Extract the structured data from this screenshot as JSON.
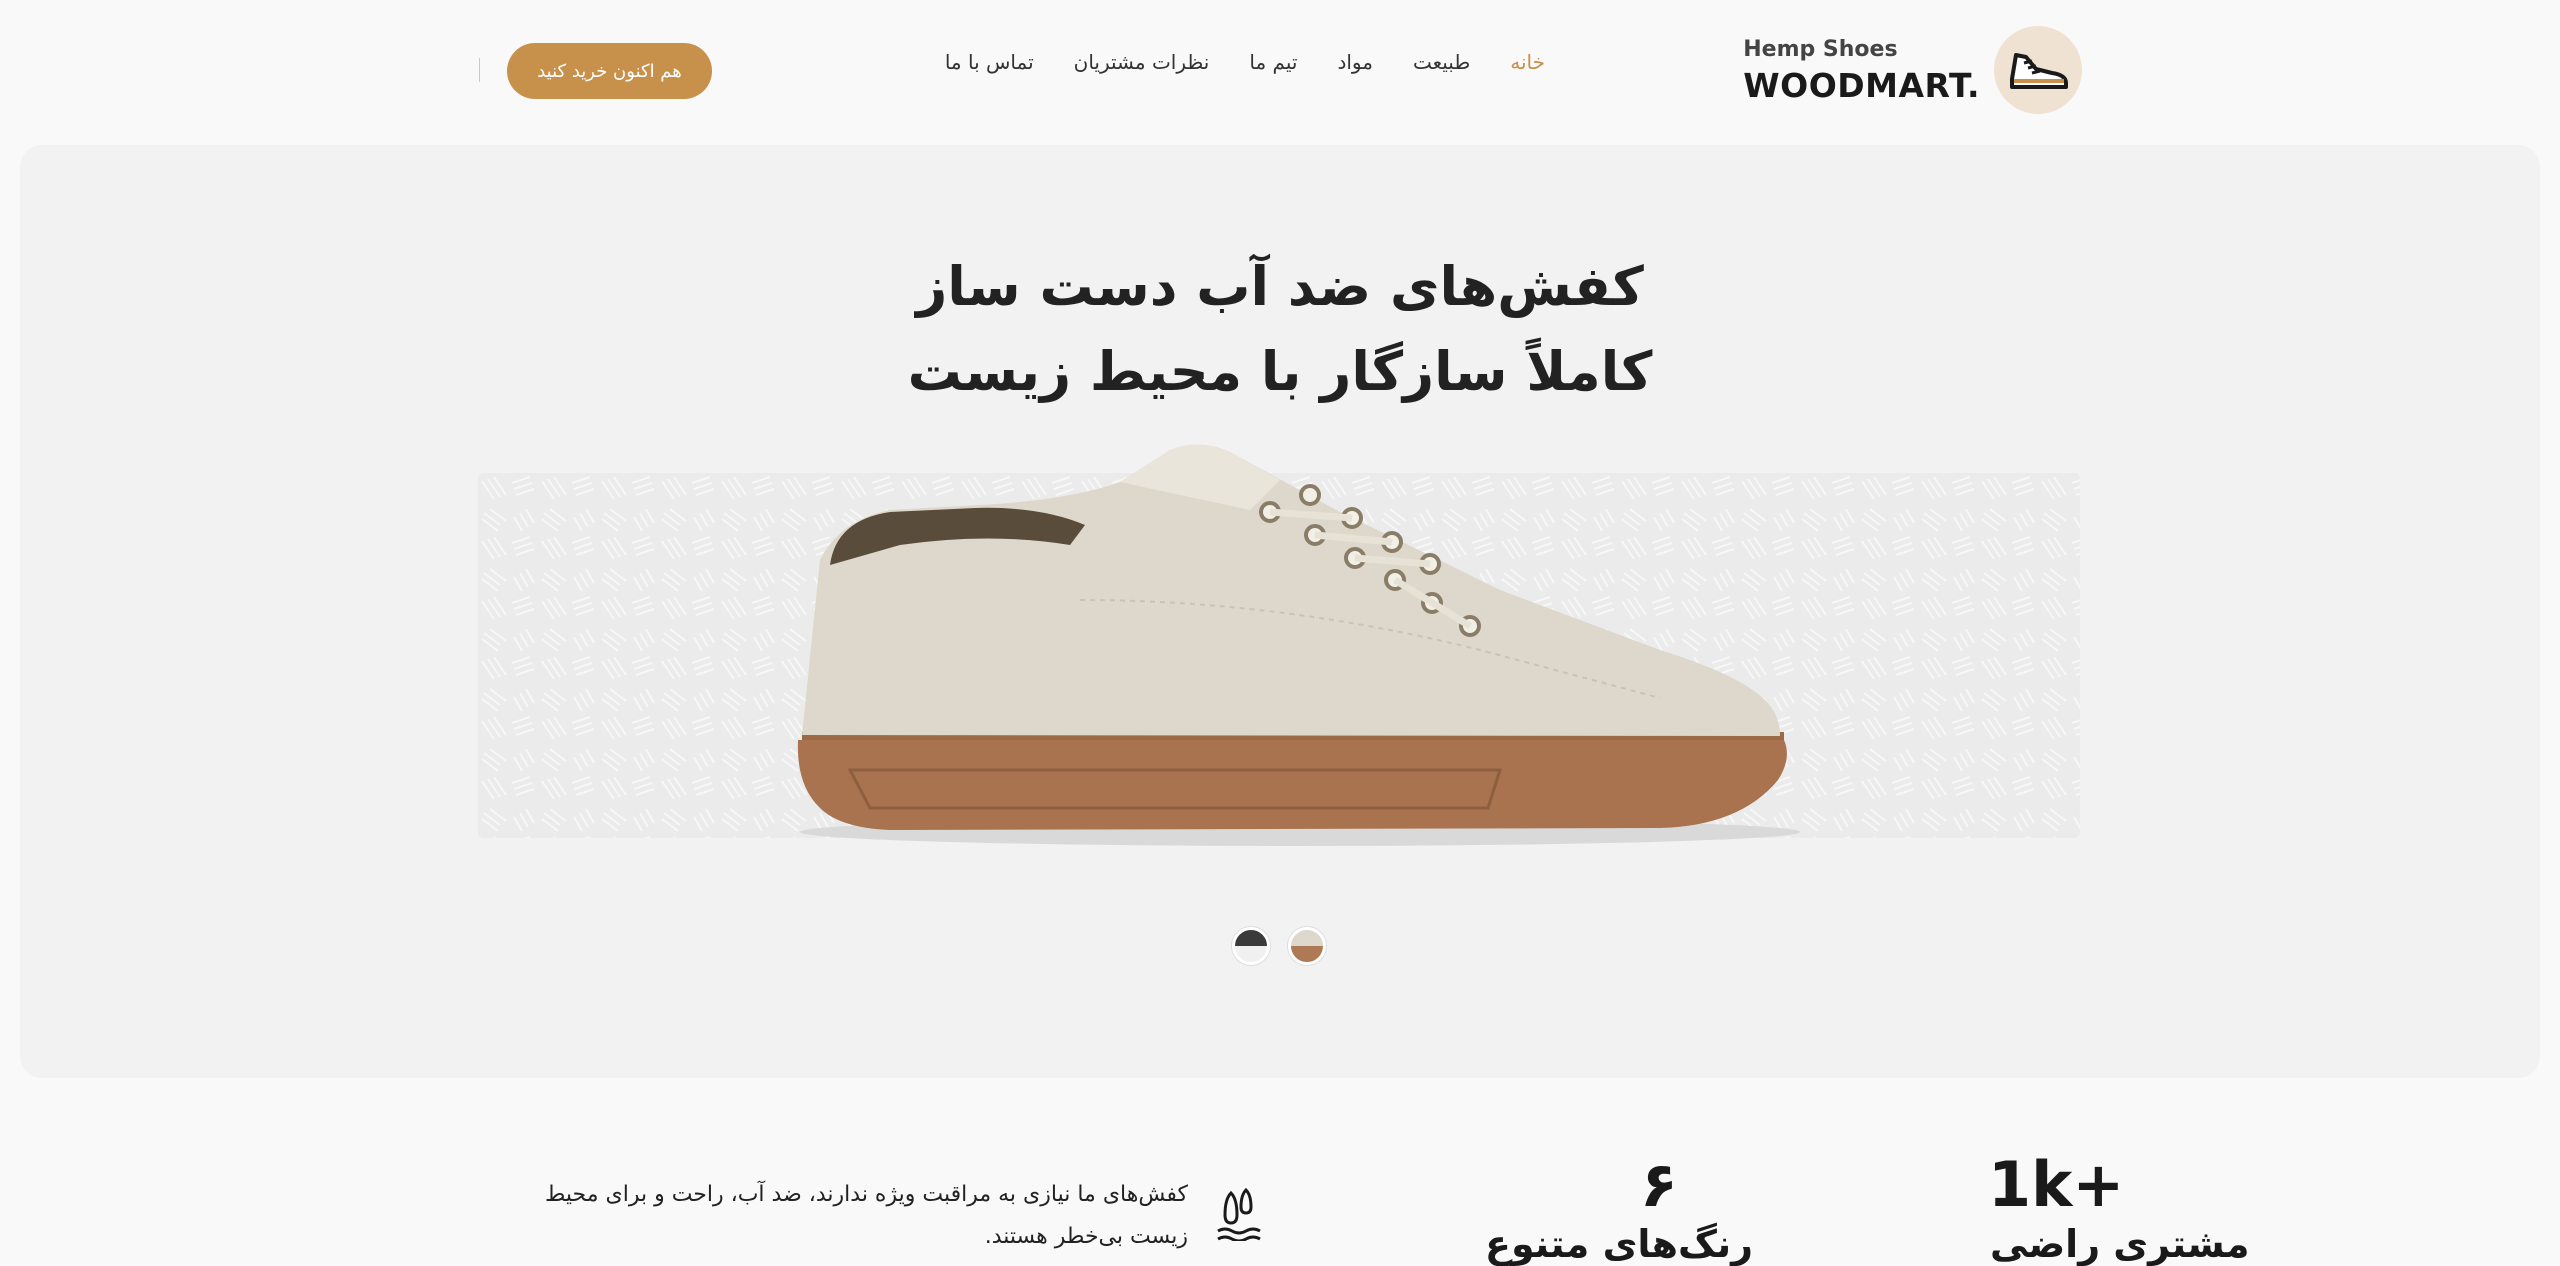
{
  "header": {
    "logo": {
      "sub": "Hemp Shoes",
      "main": "WOODMART.",
      "icon": "shoe-icon"
    },
    "nav": [
      {
        "label": "خانه",
        "active": true
      },
      {
        "label": "طبیعت",
        "active": false
      },
      {
        "label": "مواد",
        "active": false
      },
      {
        "label": "تیم ما",
        "active": false
      },
      {
        "label": "نظرات مشتریان",
        "active": false
      },
      {
        "label": "تماس با ما",
        "active": false
      }
    ],
    "cta_label": "هم اکنون خرید کنید"
  },
  "hero": {
    "title_line1": "کفش‌های ضد آب دست ساز",
    "title_line2": "کاملاً سازگار با محیط زیست",
    "swatches": [
      {
        "name": "dark",
        "color": "#3a3a3a"
      },
      {
        "name": "natural",
        "color": "#ad7a55"
      }
    ]
  },
  "stats": [
    {
      "value": "1k+",
      "label": "مشتری راضی"
    },
    {
      "value": "۶",
      "label": "رنگ‌های متنوع"
    }
  ],
  "feature": {
    "icon": "water-drop-icon",
    "text": "کفش‌های ما نیازی به مراقبت ویژه ندارند، ضد آب، راحت و برای محیط زیست بی‌خطر هستند."
  },
  "colors": {
    "accent": "#c7904b",
    "hero_bg": "#f2f2f2",
    "page_bg": "#f9f9f9"
  }
}
